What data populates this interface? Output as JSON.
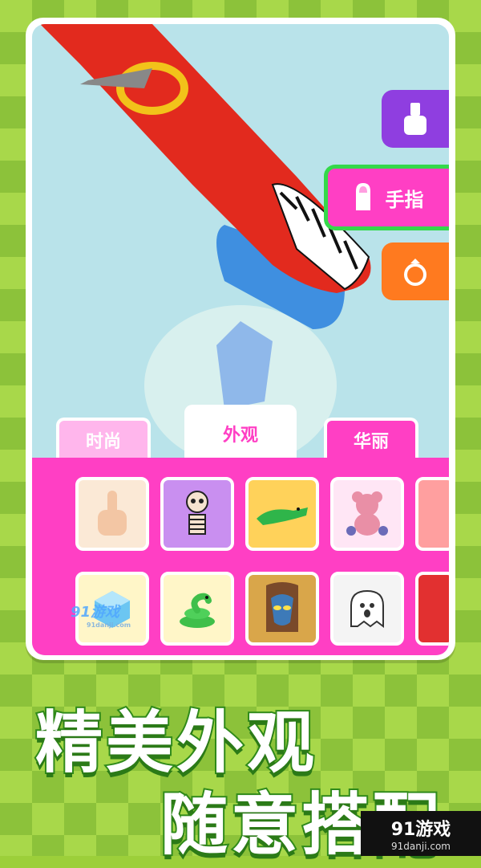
{
  "tools": {
    "polish": {
      "icon": "nail-polish-icon"
    },
    "finger": {
      "icon": "finger-nail-icon",
      "label": "手指"
    },
    "ring": {
      "icon": "ring-icon"
    }
  },
  "tabs": [
    {
      "label": "时尚"
    },
    {
      "label": "外观"
    },
    {
      "label": "华丽"
    }
  ],
  "items": [
    {
      "icon": "pointing-finger-icon"
    },
    {
      "icon": "skeleton-icon"
    },
    {
      "icon": "crocodile-icon"
    },
    {
      "icon": "teddy-bear-icon"
    },
    {
      "icon": "partial-item-icon"
    },
    {
      "icon": "ice-cube-icon"
    },
    {
      "icon": "snake-icon"
    },
    {
      "icon": "alien-mask-icon"
    },
    {
      "icon": "ghost-icon"
    },
    {
      "icon": "partial-item-icon"
    }
  ],
  "watermark": {
    "main": "91游戏",
    "sub": "91danji.com"
  },
  "headline": {
    "line1": "精美外观",
    "line2": "随意搭配"
  },
  "brand": {
    "main": "91游戏",
    "sub": "91danji.com"
  },
  "colors": {
    "accent": "#ff3fc4",
    "selected_border": "#34d94a",
    "polish_btn": "#8f3ee0",
    "ring_btn": "#ff7a1f",
    "background": "#9ccf3a"
  }
}
